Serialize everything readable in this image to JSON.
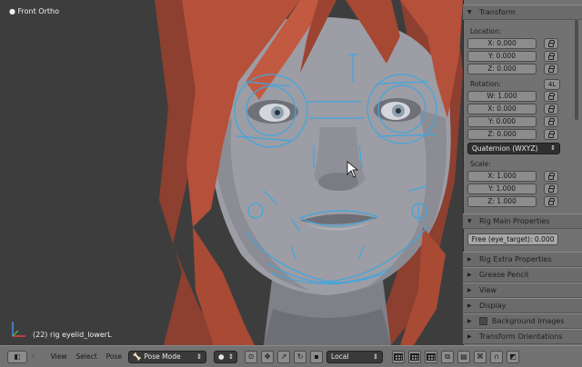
{
  "viewport": {
    "view_label": "Front Ortho",
    "status_label": "(22) rig eyelid_lowerL"
  },
  "properties": {
    "transform_header": "Transform",
    "location_label": "Location:",
    "location": [
      "X: 0.000",
      "Y: 0.000",
      "Z: 0.000"
    ],
    "rotation_label": "Rotation:",
    "rotation_badge": "4L",
    "rotation": [
      "W: 1.000",
      "X: 0.000",
      "Y: 0.000",
      "Z: 0.000"
    ],
    "rotation_mode": "Quaternion (WXYZ)",
    "scale_label": "Scale:",
    "scale": [
      "X: 1.000",
      "Y: 1.000",
      "Z: 1.000"
    ],
    "rig_main_header": "Rig Main Properties",
    "free_eye_target": "Free (eye_target): 0.000",
    "rig_extra_header": "Rig Extra Properties",
    "grease_pencil_header": "Grease Pencil",
    "view_header": "View",
    "display_header": "Display",
    "background_images_header": "Background Images",
    "transform_orientations_header": "Transform Orientations"
  },
  "bottombar": {
    "menu_view": "View",
    "menu_select": "Select",
    "menu_pose": "Pose",
    "mode": "Pose Mode",
    "orientation": "Local"
  },
  "colors": {
    "rig_lines": "#3fa6e0",
    "hair": "#b5503a",
    "skin": "#9a9ba3",
    "viewport_bg": "#3d3d3d",
    "panel_bg": "#727272"
  }
}
